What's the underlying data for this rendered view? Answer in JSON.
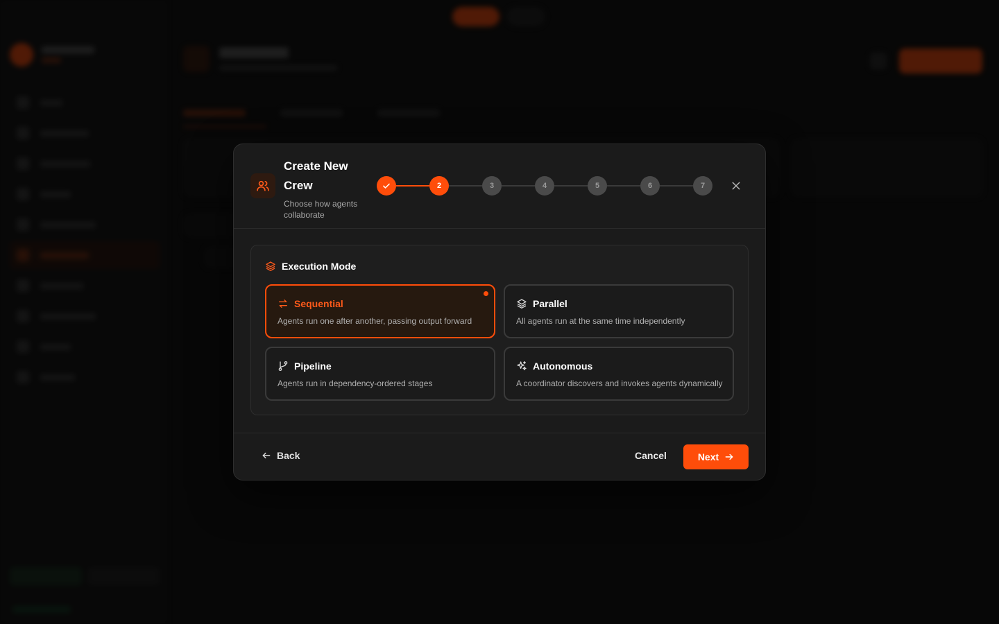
{
  "modal": {
    "title": "Create New Crew",
    "subtitle": "Choose how agents collaborate",
    "header_icon": "users-icon",
    "close_icon": "close-icon"
  },
  "stepper": {
    "completed_icon": "check-icon",
    "steps": [
      {
        "label": "",
        "state": "done"
      },
      {
        "label": "2",
        "state": "current"
      },
      {
        "label": "3",
        "state": "upcoming"
      },
      {
        "label": "4",
        "state": "upcoming"
      },
      {
        "label": "5",
        "state": "upcoming"
      },
      {
        "label": "6",
        "state": "upcoming"
      },
      {
        "label": "7",
        "state": "upcoming"
      }
    ]
  },
  "execution_mode": {
    "title": "Execution Mode",
    "title_icon": "layers-icon",
    "selected": "sequential",
    "options": [
      {
        "id": "sequential",
        "icon": "swap-arrows-icon",
        "label": "Sequential",
        "description": "Agents run one after another, passing output forward"
      },
      {
        "id": "parallel",
        "icon": "layers-icon",
        "label": "Parallel",
        "description": "All agents run at the same time independently"
      },
      {
        "id": "pipeline",
        "icon": "git-branch-icon",
        "label": "Pipeline",
        "description": "Agents run in dependency-ordered stages"
      },
      {
        "id": "autonomous",
        "icon": "sparkles-icon",
        "label": "Autonomous",
        "description": "A coordinator discovers and invokes agents dynamically"
      }
    ]
  },
  "footer": {
    "back_label": "Back",
    "cancel_label": "Cancel",
    "next_label": "Next"
  },
  "colors": {
    "accent": "#ff4d0a",
    "modal_bg": "#1b1b1b",
    "page_bg": "#0d0d0d"
  }
}
